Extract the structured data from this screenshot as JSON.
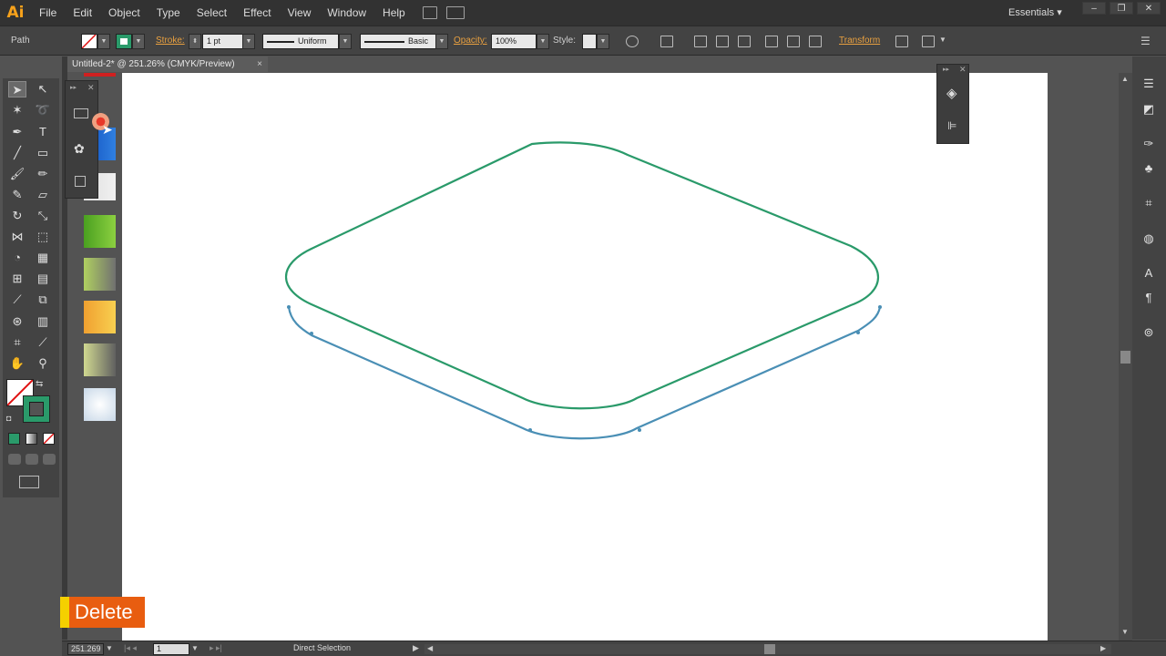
{
  "app": {
    "logo": "Ai",
    "workspace": "Essentials"
  },
  "menu": [
    "File",
    "Edit",
    "Object",
    "Type",
    "Select",
    "Effect",
    "View",
    "Window",
    "Help"
  ],
  "control_bar": {
    "selection_type": "Path",
    "stroke_label": "Stroke:",
    "stroke_weight": "1 pt",
    "profile": "Uniform",
    "brush": "Basic",
    "opacity_label": "Opacity:",
    "opacity_value": "100%",
    "style_label": "Style:",
    "transform_label": "Transform"
  },
  "document": {
    "tab_title": "Untitled-2* @ 251.26% (CMYK/Preview)",
    "close_glyph": "×"
  },
  "status_bar": {
    "zoom": "251.269",
    "page": "1",
    "current_tool": "Direct Selection"
  },
  "overlay": {
    "key_label": "Delete"
  },
  "colors": {
    "top_shape_stroke": "#2a9a6a",
    "bottom_path_stroke": "#4a8fb5",
    "accent": "#e8a040",
    "delete_badge": "#e85d10"
  }
}
